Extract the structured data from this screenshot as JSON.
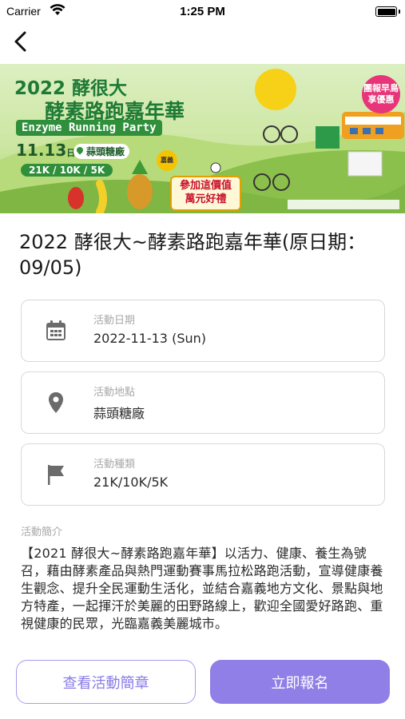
{
  "status_bar": {
    "carrier": "Carrier",
    "time": "1:25 PM"
  },
  "nav": {
    "back_icon": "chevron-left-icon"
  },
  "banner": {
    "year_line": "2022 酵很大",
    "title_line": "酵素路跑嘉年華",
    "english_title": "Enzyme Running Party",
    "date": "11.13",
    "date_suffix": "日",
    "location": "蒜頭糖廠",
    "distances": "21K / 10K / 5K",
    "promo_line1": "參加這價值",
    "promo_line2": "萬元好禮",
    "badge_line1": "團報早鳥",
    "badge_line2": "享優惠",
    "city_tag": "嘉義"
  },
  "event": {
    "title": "2022 酵很大~酵素路跑嘉年華(原日期：09/05)"
  },
  "info": {
    "date": {
      "label": "活動日期",
      "value": "2022-11-13 (Sun)",
      "icon": "calendar-icon"
    },
    "location": {
      "label": "活動地點",
      "value": "蒜頭糖廠",
      "icon": "location-pin-icon"
    },
    "category": {
      "label": "活動種類",
      "value": "21K/10K/5K",
      "icon": "flag-icon"
    }
  },
  "description": {
    "label": "活動簡介",
    "text": "【2021 酵很大~酵素路跑嘉年華】以活力、健康、養生為號召，藉由酵素產品與熱門運動賽事馬拉松路跑活動，宣導健康養生觀念、提升全民運動生活化，並結合嘉義地方文化、景點與地方特產，一起揮汗於美麗的田野路線上，歡迎全國愛好路跑、重視健康的民眾，光臨嘉義美麗城市。"
  },
  "actions": {
    "brochure_label": "查看活動簡章",
    "register_label": "立即報名"
  },
  "colors": {
    "accent": "#8f7fe6",
    "accent_outline": "#a89af0",
    "banner_green": "#2f8f3b"
  }
}
